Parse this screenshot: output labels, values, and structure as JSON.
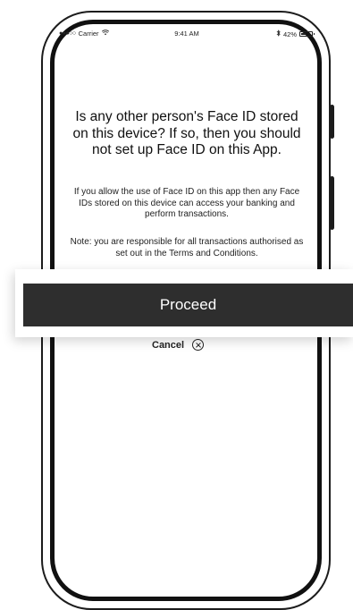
{
  "status_bar": {
    "signal": "●●●○○",
    "carrier": "Carrier",
    "wifi_icon": "wifi-icon",
    "time": "9:41 AM",
    "bluetooth_icon": "bluetooth-icon",
    "battery_percent": "42%",
    "battery_level": 0.42
  },
  "dialog": {
    "heading": "Is any other person's Face ID stored on this device? If so, then you should not set up Face ID on this App.",
    "body": "If you allow the use of Face ID on this app then any Face IDs stored on this device can access your banking and perform transactions.",
    "note": "Note: you are responsible for all transactions authorised as set out in the Terms and Conditions."
  },
  "actions": {
    "proceed_label": "Proceed",
    "cancel_label": "Cancel",
    "cancel_icon": "close-circle-icon"
  },
  "colors": {
    "primary_button": "#2e2e2e",
    "text": "#111111"
  }
}
